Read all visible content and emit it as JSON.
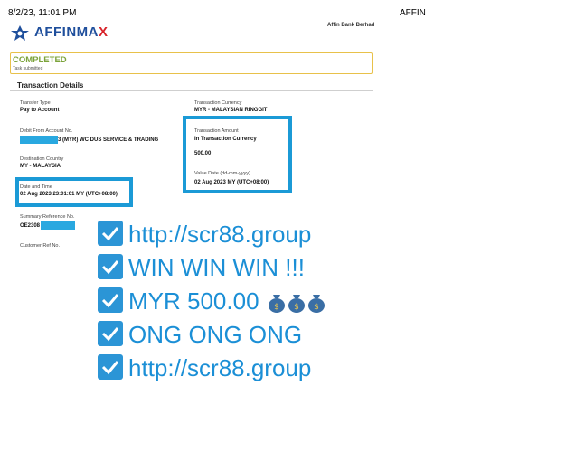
{
  "print_header": {
    "datetime": "8/2/23, 11:01 PM",
    "right_title": "AFFIN"
  },
  "logo": {
    "text_main": "AFFINMA",
    "text_accent": "X"
  },
  "bank_name": "Affin Bank Berhad",
  "status": {
    "title": "COMPLETED",
    "subtitle": "Task submitted"
  },
  "section_title": "Transaction Details",
  "left_fields": [
    {
      "label": "Transfer Type",
      "value": "Pay to Account"
    },
    {
      "label": "Debit From Account No.",
      "value": "3 (MYR) WC DUS SERVICE & TRADING"
    },
    {
      "label": "Destination Country",
      "value": "MY - MALAYSIA"
    },
    {
      "label": "Date and Time",
      "value": "02 Aug 2023 23:01:01 MY (UTC+08:00)"
    },
    {
      "label": "Summary Reference No.",
      "value": "OE2308"
    },
    {
      "label": "Customer Ref No.",
      "value": ""
    }
  ],
  "right_fields": [
    {
      "label": "Transaction Currency",
      "value": "MYR - MALAYSIAN RINGGIT"
    },
    {
      "label": "Transaction Amount",
      "value": "In Transaction Currency"
    },
    {
      "label": "",
      "value": "500.00"
    },
    {
      "label": "Value Date (dd-mm-yyyy)",
      "value": "02 Aug 2023 MY (UTC+08:00)"
    }
  ],
  "promo_lines": [
    "http://scr88.group",
    "WIN WIN WIN !!!",
    "MYR 500.00",
    "ONG ONG ONG",
    "http://scr88.group"
  ],
  "colors": {
    "promo_blue": "#1b8fd6",
    "check_blue": "#2b95d6",
    "highlight_blue": "#1b9ad6",
    "status_green": "#7ba33a",
    "status_border": "#e8c14a",
    "logo_blue": "#1f4f9c",
    "logo_red": "#d8232a"
  },
  "icons": {
    "check": "check-mark-button-icon",
    "money_bag": "money-bag-icon"
  }
}
